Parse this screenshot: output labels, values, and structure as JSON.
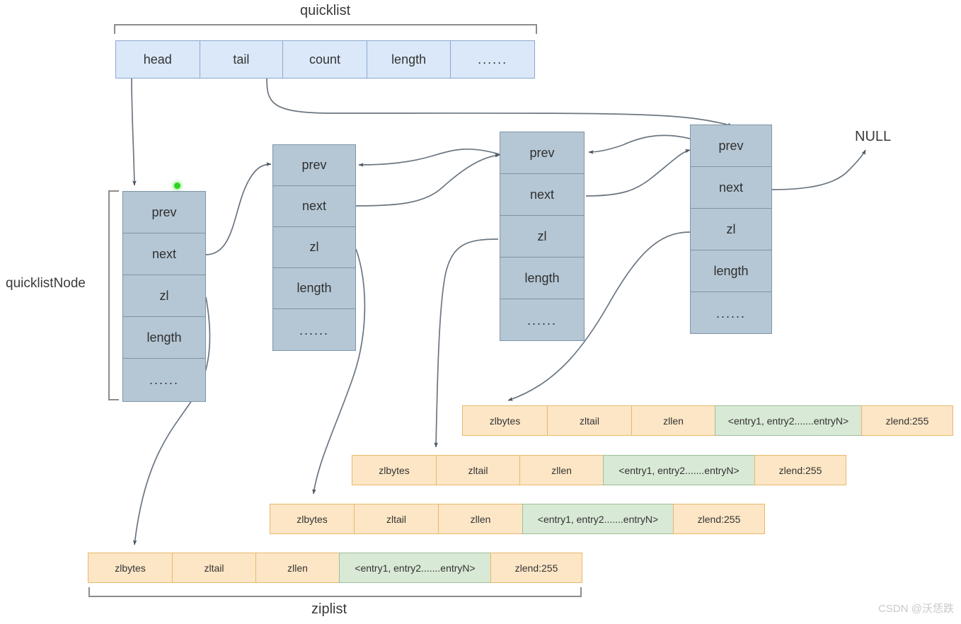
{
  "diagram": {
    "labels": {
      "quicklist": "quicklist",
      "quicklistNode": "quicklistNode",
      "ziplist": "ziplist",
      "null": "NULL"
    },
    "watermark": "CSDN @沃恁跌",
    "colors": {
      "quicklist_fill": "#dbe8fa",
      "quicklist_border": "#8ba8cc",
      "node_fill": "#b5c7d5",
      "node_border": "#7d94a6",
      "ziplist_fill": "#fce6c6",
      "ziplist_border": "#e8b96a",
      "entries_fill": "#d8e9d5",
      "entries_border": "#9cbf98",
      "arrow": "#5a6673",
      "bracket": "#8c8c8c",
      "marker_dot": "#2fd21f"
    },
    "quicklist_fields": [
      "head",
      "tail",
      "count",
      "length",
      "......"
    ],
    "node_fields": [
      "prev",
      "next",
      "zl",
      "length",
      "......"
    ],
    "nodes": [
      {
        "name": "node-1",
        "fields": [
          "prev",
          "next",
          "zl",
          "length",
          "......"
        ]
      },
      {
        "name": "node-2",
        "fields": [
          "prev",
          "next",
          "zl",
          "length",
          "......"
        ]
      },
      {
        "name": "node-3",
        "fields": [
          "prev",
          "next",
          "zl",
          "length",
          "......"
        ]
      },
      {
        "name": "node-4",
        "fields": [
          "prev",
          "next",
          "zl",
          "length",
          "......"
        ]
      }
    ],
    "ziplist_fields": [
      "zlbytes",
      "zltail",
      "zllen",
      "<entry1, entry2.......entryN>",
      "zlend:255"
    ],
    "ziplists": [
      {
        "name": "ziplist-1",
        "cells": [
          "zlbytes",
          "zltail",
          "zllen",
          "<entry1, entry2.......entryN>",
          "zlend:255"
        ]
      },
      {
        "name": "ziplist-2",
        "cells": [
          "zlbytes",
          "zltail",
          "zllen",
          "<entry1, entry2.......entryN>",
          "zlend:255"
        ]
      },
      {
        "name": "ziplist-3",
        "cells": [
          "zlbytes",
          "zltail",
          "zllen",
          "<entry1, entry2.......entryN>",
          "zlend:255"
        ]
      },
      {
        "name": "ziplist-4",
        "cells": [
          "zlbytes",
          "zltail",
          "zllen",
          "<entry1, entry2.......entryN>",
          "zlend:255"
        ]
      }
    ]
  }
}
